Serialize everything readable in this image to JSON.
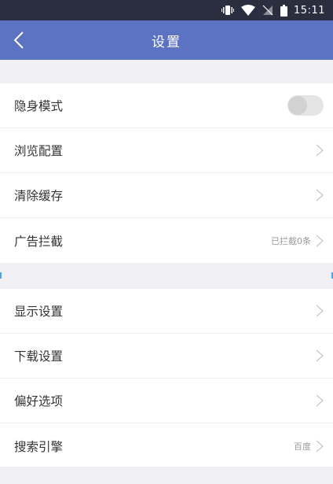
{
  "status_bar": {
    "time": "15:11",
    "icons": [
      "vibrate-icon",
      "wifi-icon",
      "no-sim-icon",
      "battery-icon"
    ]
  },
  "header": {
    "title": "设置",
    "back_icon": "chevron-left-icon"
  },
  "colors": {
    "status_bar_bg": "#2b2e3f",
    "header_bg": "#5c73c4",
    "page_bg": "#efeff4"
  },
  "settings": {
    "group1": [
      {
        "label": "隐身模式",
        "control": "toggle",
        "toggle_on": false
      },
      {
        "label": "浏览配置",
        "control": "chevron"
      },
      {
        "label": "清除缓存",
        "control": "chevron"
      },
      {
        "label": "广告拦截",
        "control": "chevron",
        "value": "已拦截0条"
      }
    ],
    "group2": [
      {
        "label": "显示设置",
        "control": "chevron"
      },
      {
        "label": "下载设置",
        "control": "chevron"
      },
      {
        "label": "偏好选项",
        "control": "chevron"
      },
      {
        "label": "搜索引擎",
        "control": "chevron",
        "value": "百度"
      }
    ]
  }
}
